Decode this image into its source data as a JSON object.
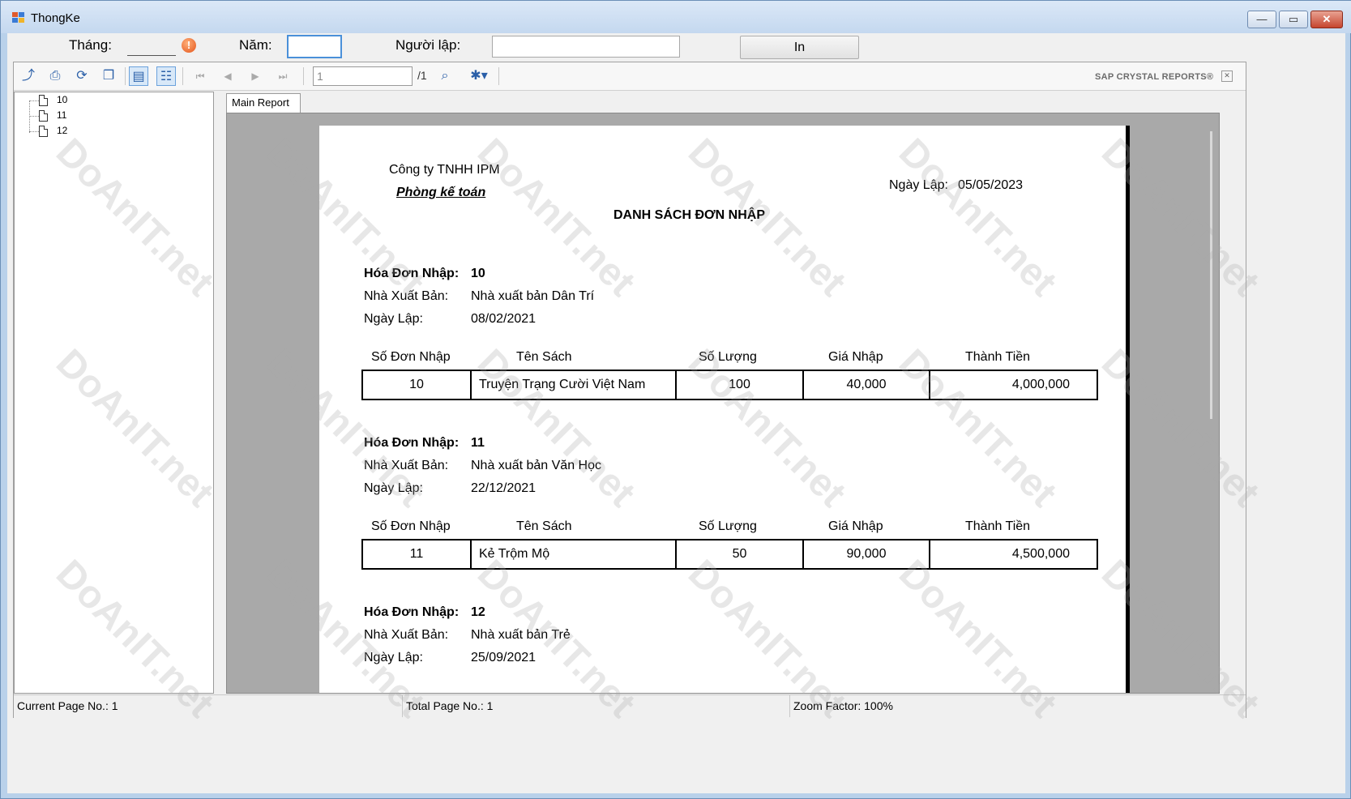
{
  "window": {
    "title": "ThongKe",
    "controls": {
      "minimize": "—",
      "maximize": "▭",
      "close": "✕"
    }
  },
  "filters": {
    "month_label": "Tháng:",
    "month_value": "",
    "year_label": "Năm:",
    "year_value": "",
    "creator_label": "Người lập:",
    "creator_value": "",
    "print_button": "In",
    "error_icon": "!"
  },
  "toolbar": {
    "icons": [
      "export-icon",
      "print-icon",
      "refresh-icon",
      "copy-icon",
      "toggle-parameter-icon",
      "toggle-group-tree-icon",
      "first-page-icon",
      "prev-page-icon",
      "next-page-icon",
      "last-page-icon",
      "find-icon",
      "zoom-icon"
    ],
    "page_input": "1",
    "page_total": "/1",
    "brand": "SAP CRYSTAL REPORTS®"
  },
  "tree": {
    "items": [
      "10",
      "11",
      "12"
    ]
  },
  "tabs": {
    "main": "Main Report"
  },
  "report": {
    "company": "Công ty TNHH IPM",
    "department": "Phòng kế toán",
    "date_label": "Ngày Lập:",
    "date_value": "05/05/2023",
    "title": "DANH SÁCH ĐƠN NHẬP",
    "labels": {
      "invoice": "Hóa Đơn Nhập:",
      "publisher": "Nhà Xuất Bản:",
      "created": "Ngày Lập:"
    },
    "columns": [
      "Số Đơn Nhập",
      "Tên Sách",
      "Số Lượng",
      "Giá Nhập",
      "Thành Tiền"
    ],
    "orders": [
      {
        "id": "10",
        "publisher": "Nhà xuất bản Dân Trí",
        "date": "08/02/2021",
        "row": [
          "10",
          "Truyện Trạng Cười Việt Nam",
          "100",
          "40,000",
          "4,000,000"
        ]
      },
      {
        "id": "11",
        "publisher": "Nhà xuất bản Văn Học",
        "date": "22/12/2021",
        "row": [
          "11",
          "Kẻ Trộm Mộ",
          "50",
          "90,000",
          "4,500,000"
        ]
      },
      {
        "id": "12",
        "publisher": "Nhà xuất bản Trẻ",
        "date": "25/09/2021"
      }
    ]
  },
  "status": {
    "current_page": "Current Page No.: 1",
    "total_page": "Total Page No.: 1",
    "zoom": "Zoom Factor: 100%"
  },
  "watermark": {
    "text": "DoAnIT.net"
  }
}
